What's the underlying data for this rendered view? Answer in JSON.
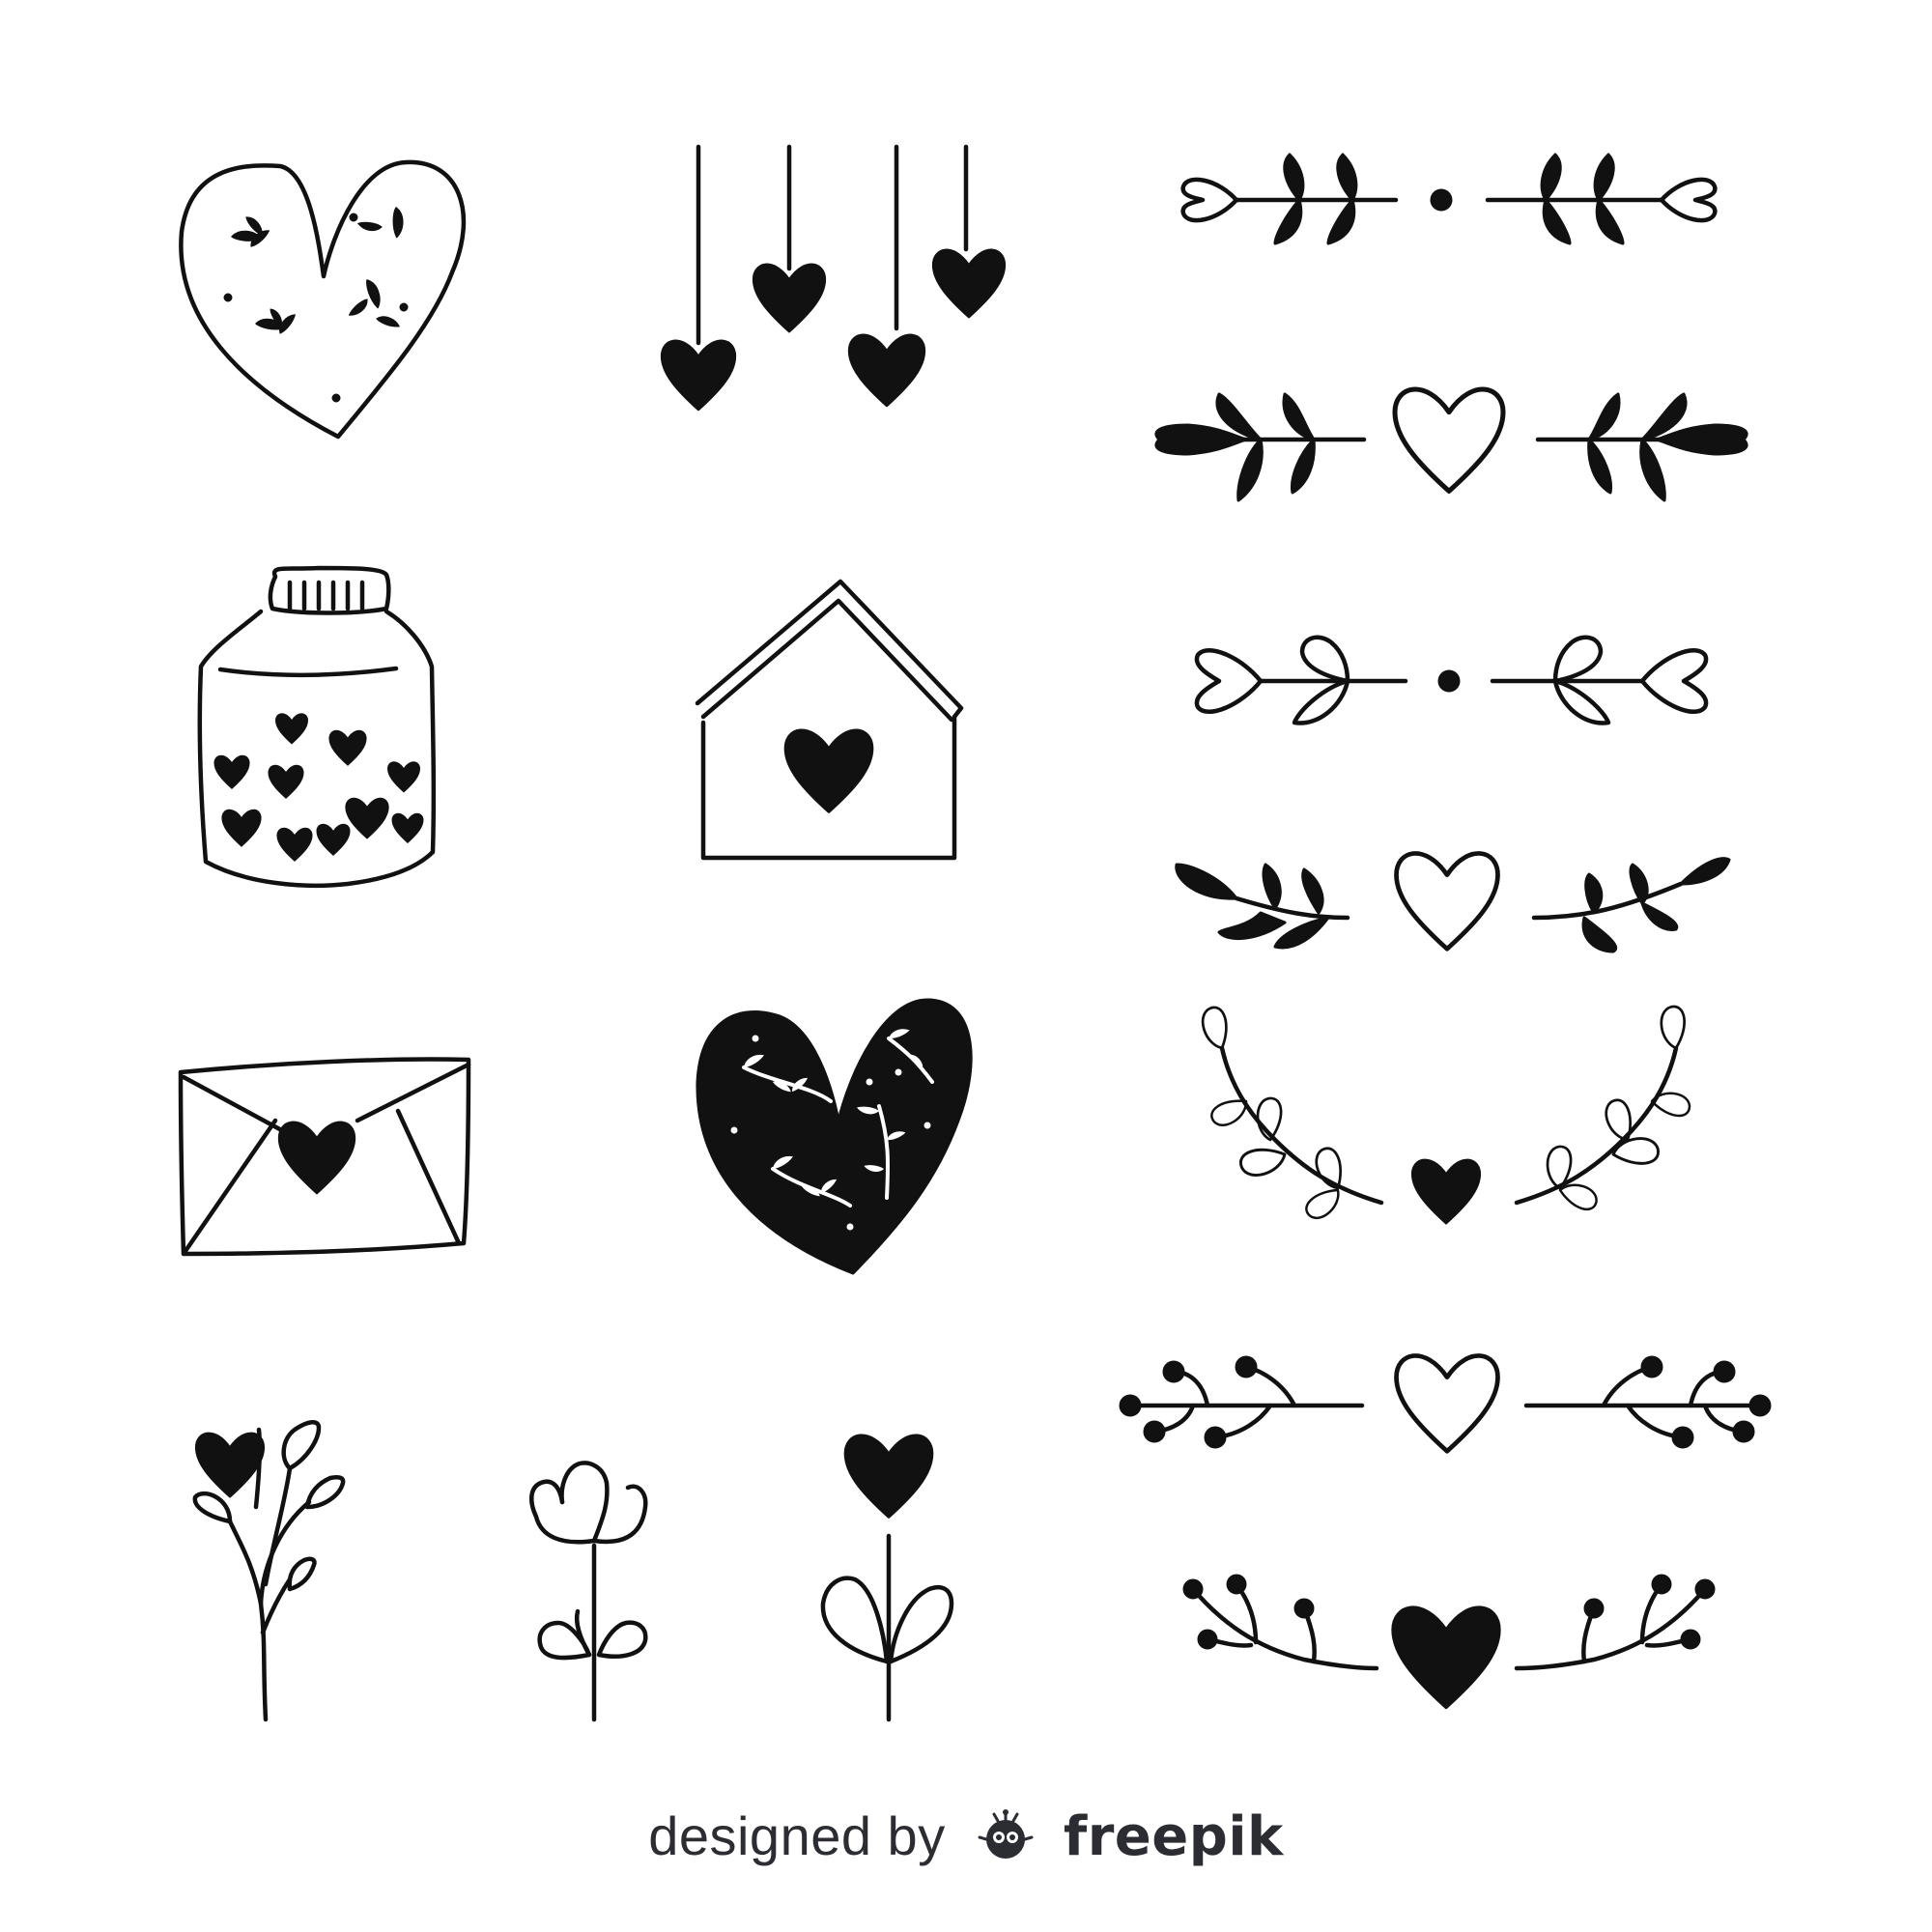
{
  "credit": {
    "prefix": "designed by",
    "brand": "freepik",
    "logo_icon": "freepik-logo-icon",
    "text_color": "#2b2d33"
  },
  "palette": {
    "ink": "#111111",
    "background": "#ffffff"
  },
  "ornaments": [
    "decorated-heart-outline",
    "hanging-hearts",
    "heart-jar",
    "house-with-heart",
    "envelope-with-heart",
    "decorated-heart-filled",
    "heart-flower-sprig",
    "tulip-flower",
    "heart-flower",
    "heart-leaf-dividers"
  ]
}
